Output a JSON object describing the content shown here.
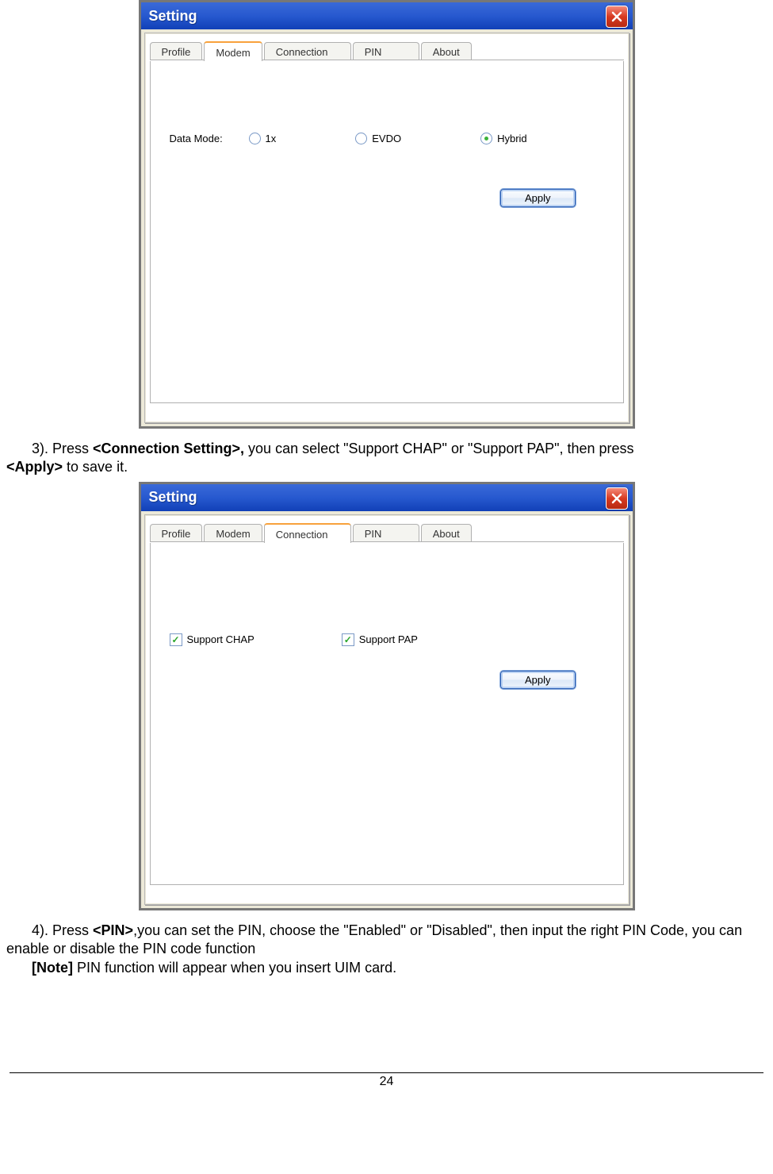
{
  "window1": {
    "title": "Setting",
    "tabs": [
      "Profile",
      "Modem",
      "Connection",
      "PIN",
      "About"
    ],
    "activeTab": 1,
    "dataModeLabel": "Data Mode:",
    "radios": [
      {
        "label": "1x",
        "checked": false
      },
      {
        "label": "EVDO",
        "checked": false
      },
      {
        "label": "Hybrid",
        "checked": true
      }
    ],
    "apply": "Apply"
  },
  "instr1": {
    "lead": "3). Press ",
    "b1": "<Connection Setting>,",
    "mid": " you can select  \"Support CHAP\" or \"Support PAP\", then press ",
    "b2": "<Apply>",
    "tail": " to save it."
  },
  "window2": {
    "title": "Setting",
    "tabs": [
      "Profile",
      "Modem",
      "Connection",
      "PIN",
      "About"
    ],
    "activeTab": 2,
    "checks": [
      {
        "label": "Support CHAP",
        "checked": true
      },
      {
        "label": "Support PAP",
        "checked": true
      }
    ],
    "apply": "Apply"
  },
  "instr2": {
    "lead": "4). Press ",
    "b1": "<PIN>",
    "mid": ",you can set the PIN, choose the \"Enabled\" or \"Disabled\", then input the right PIN Code, you can enable or disable the PIN code function",
    "noteLabel": "[Note]",
    "noteText": " PIN function will appear when you insert UIM card."
  },
  "pageNumber": "24"
}
